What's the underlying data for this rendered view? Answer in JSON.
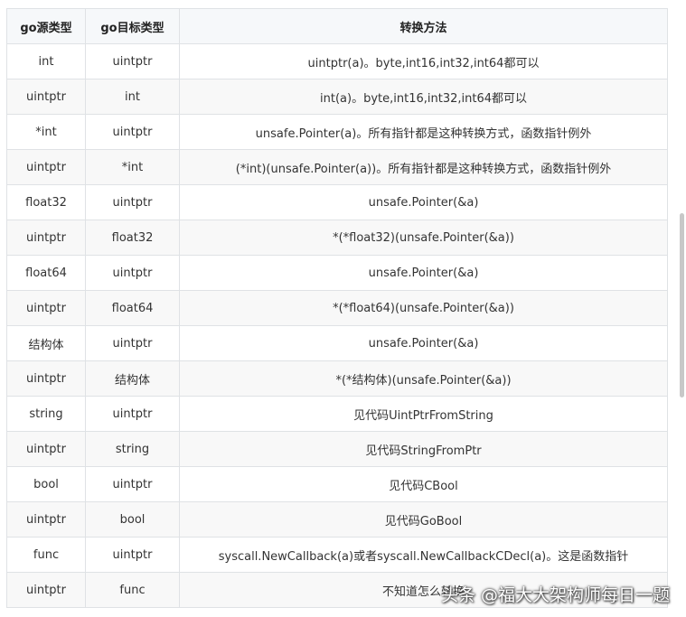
{
  "table": {
    "headers": [
      "go源类型",
      "go目标类型",
      "转换方法"
    ],
    "rows": [
      [
        "int",
        "uintptr",
        "uintptr(a)。byte,int16,int32,int64都可以"
      ],
      [
        "uintptr",
        "int",
        "int(a)。byte,int16,int32,int64都可以"
      ],
      [
        "*int",
        "uintptr",
        "unsafe.Pointer(a)。所有指针都是这种转换方式，函数指针例外"
      ],
      [
        "uintptr",
        "*int",
        "(*int)(unsafe.Pointer(a))。所有指针都是这种转换方式，函数指针例外"
      ],
      [
        "float32",
        "uintptr",
        "unsafe.Pointer(&a)"
      ],
      [
        "uintptr",
        "float32",
        "*(*float32)(unsafe.Pointer(&a))"
      ],
      [
        "float64",
        "uintptr",
        "unsafe.Pointer(&a)"
      ],
      [
        "uintptr",
        "float64",
        "*(*float64)(unsafe.Pointer(&a))"
      ],
      [
        "结构体",
        "uintptr",
        "unsafe.Pointer(&a)"
      ],
      [
        "uintptr",
        "结构体",
        "*(*结构体)(unsafe.Pointer(&a))"
      ],
      [
        "string",
        "uintptr",
        "见代码UintPtrFromString"
      ],
      [
        "uintptr",
        "string",
        "见代码StringFromPtr"
      ],
      [
        "bool",
        "uintptr",
        "见代码CBool"
      ],
      [
        "uintptr",
        "bool",
        "见代码GoBool"
      ],
      [
        "func",
        "uintptr",
        "syscall.NewCallback(a)或者syscall.NewCallbackCDecl(a)。这是函数指针"
      ],
      [
        "uintptr",
        "func",
        "不知道怎么转换"
      ]
    ]
  },
  "watermark": "头条 @福大大架构师每日一题",
  "colors": {
    "header_bg": "#f6f8fa",
    "border": "#dfe2e5",
    "stripe": "#f8f8f8"
  }
}
